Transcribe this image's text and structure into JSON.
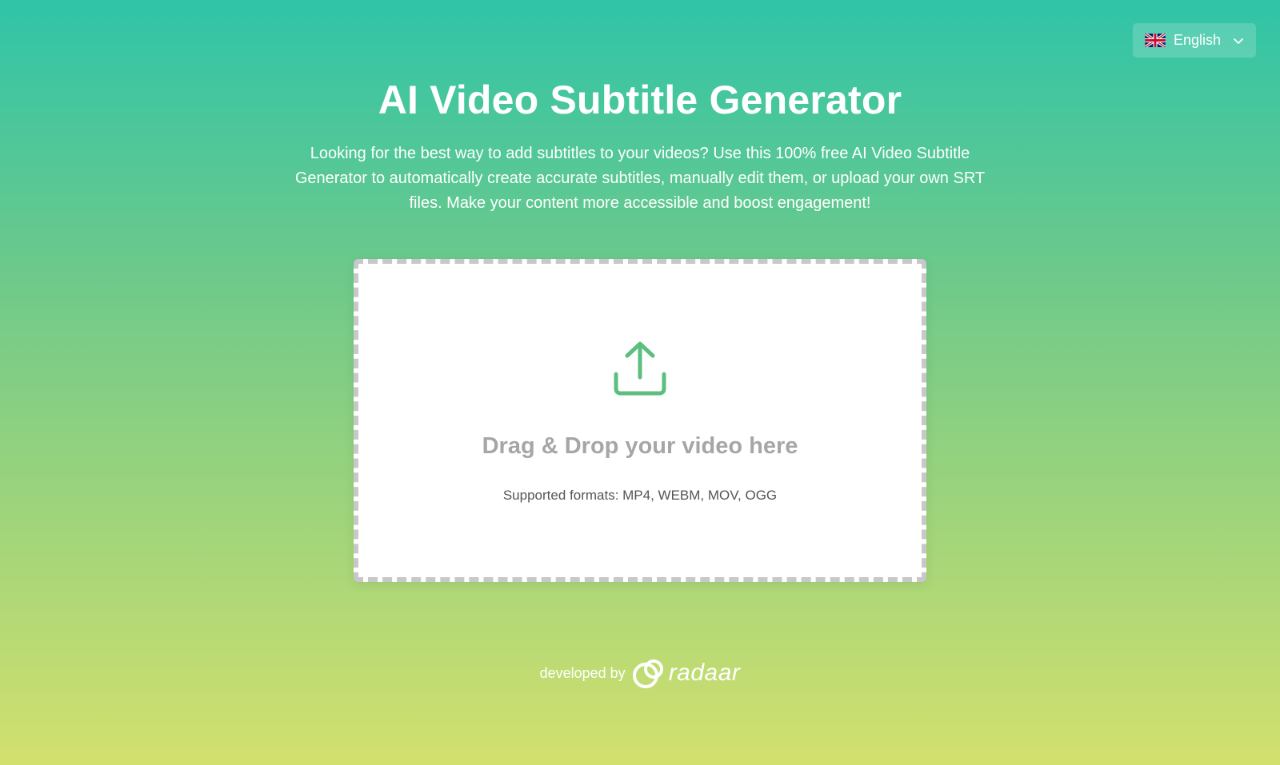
{
  "language": {
    "selected": "English",
    "flag_icon": "uk-flag-icon",
    "chevron_icon": "chevron-down-icon"
  },
  "header": {
    "title": "AI Video Subtitle Generator",
    "description": "Looking for the best way to add subtitles to your videos? Use this 100% free AI Video Subtitle Generator to automatically create accurate subtitles, manually edit them, or upload your own SRT files. Make your content more accessible and boost engagement!"
  },
  "upload": {
    "icon": "upload-icon",
    "title": "Drag & Drop your video here",
    "formats": "Supported formats: MP4, WEBM, MOV, OGG"
  },
  "footer": {
    "developed_by": "developed by",
    "brand": "radaar",
    "brand_icon": "radaar-logo-icon"
  },
  "colors": {
    "gradient_top": "#2fc4a8",
    "gradient_bottom": "#d3e06e",
    "accent": "#5cbf7f",
    "drop_title": "#a6a6a6",
    "dropzone_border": "#c8c8c8"
  }
}
